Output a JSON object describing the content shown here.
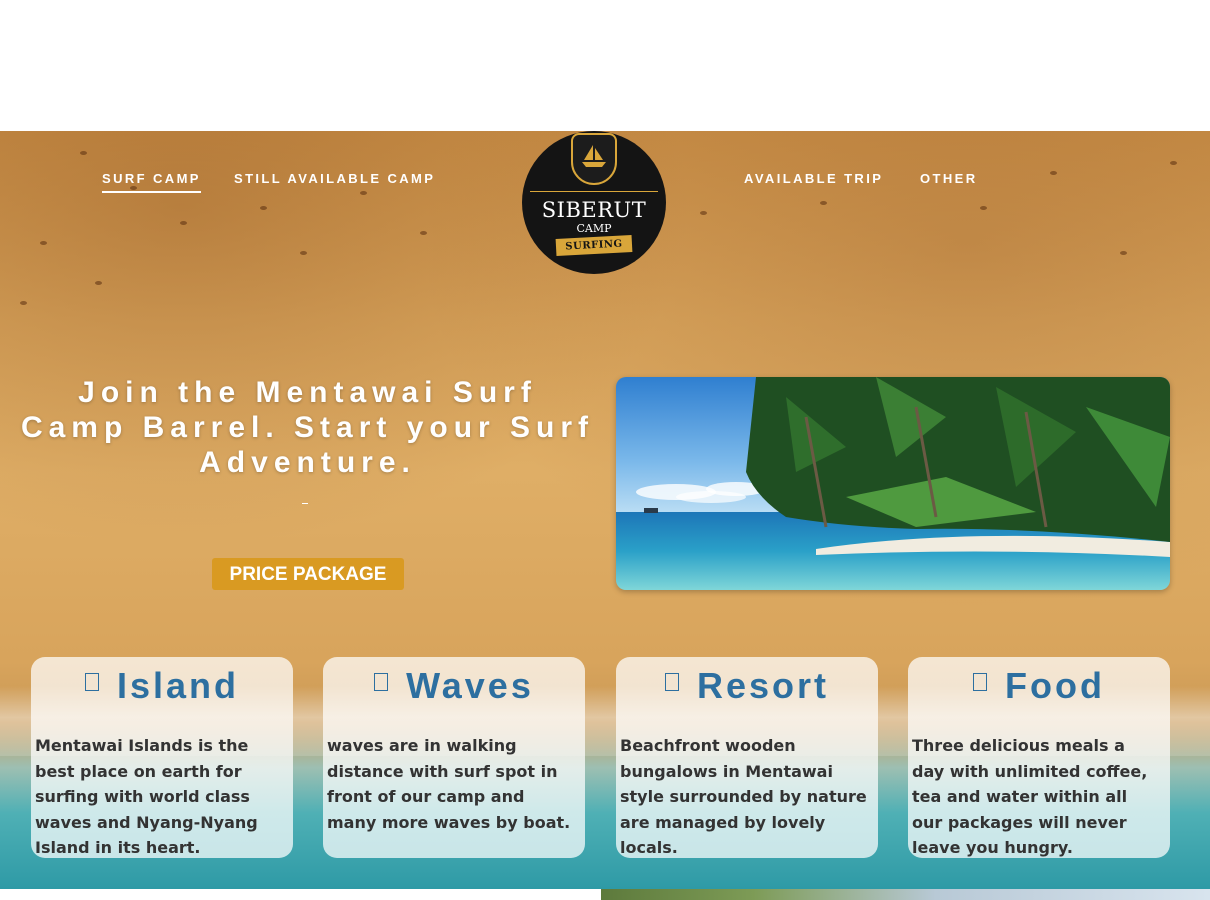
{
  "nav": {
    "left": [
      {
        "label": "SURF CAMP",
        "active": true
      },
      {
        "label": "STILL AVAILABLE CAMP",
        "active": false
      }
    ],
    "right": [
      {
        "label": "AVAILABLE TRIP",
        "active": false
      },
      {
        "label": "OTHER",
        "active": false
      }
    ]
  },
  "logo": {
    "title": "SIBERUT",
    "subtitle": "CAMP",
    "ribbon": "SURFING"
  },
  "hero": {
    "headline": "Join the Mentawai Surf Camp Barrel. Start your Surf Adventure.",
    "cta_label": "PRICE PACKAGE"
  },
  "features": [
    {
      "icon": "island-icon",
      "title": "Island",
      "text": "Mentawai Islands is the best place on earth for surfing with world class waves and Nyang-Nyang Island in its heart."
    },
    {
      "icon": "wave-icon",
      "title": "Waves",
      "text": "waves are in walking distance with surf spot in front of our camp and many more waves by boat."
    },
    {
      "icon": "resort-icon",
      "title": "Resort",
      "text": "Beachfront wooden bungalows in Mentawai style surrounded by nature are managed by lovely locals."
    },
    {
      "icon": "food-icon",
      "title": "Food",
      "text": "Three delicious meals a day with unlimited coffee, tea and water within all our packages will never leave you hungry."
    }
  ],
  "colors": {
    "accent_cta": "#d99a22",
    "feature_title": "#2d6fa0",
    "logo_gold": "#d9a63a"
  }
}
